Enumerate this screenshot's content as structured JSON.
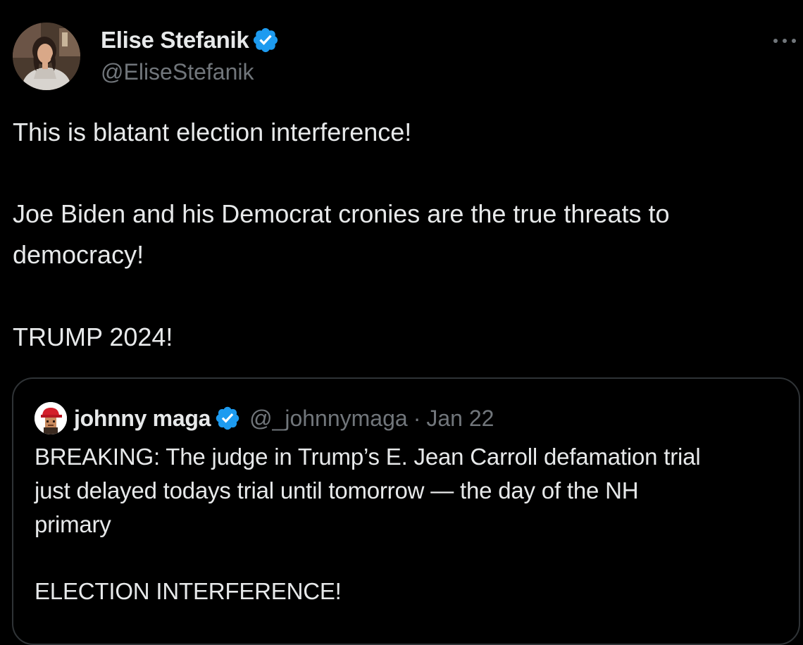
{
  "author": {
    "name": "Elise Stefanik",
    "handle": "@EliseStefanik",
    "verified": true
  },
  "post": {
    "line_1": "This is blatant election interference!",
    "line_2": "Joe Biden and his Democrat cronies are the true threats to",
    "line_3": "democracy!",
    "line_4": "TRUMP 2024!"
  },
  "quoted_post": {
    "name": "johnny maga",
    "handle": "@_johnnymaga",
    "separator": "·",
    "date": "Jan 22",
    "line_1": "BREAKING: The judge in Trump’s E. Jean Carroll defamation trial",
    "line_2": "just delayed todays trial until tomorrow — the day of the NH",
    "line_3": "primary",
    "line_4": "ELECTION INTERFERENCE!"
  },
  "icons": {
    "verified": "verified-badge-icon",
    "more": "more-options-icon"
  },
  "colors": {
    "background": "#000000",
    "primary_text": "#e7e9ea",
    "secondary_text": "#71767b",
    "verified_blue": "#1d9bf0",
    "card_border": "#2f3336"
  }
}
